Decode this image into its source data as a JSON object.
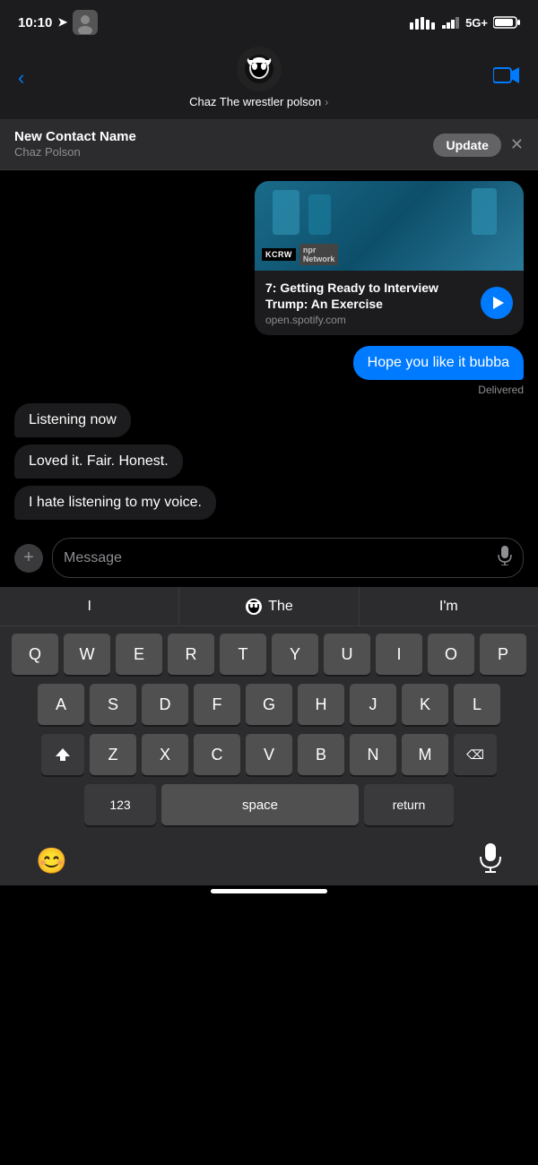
{
  "status_bar": {
    "time": "10:10",
    "network": "5G+",
    "signal_bars": "▂▄▆█"
  },
  "nav_bar": {
    "back_label": "‹",
    "contact_name": "Chaz The wrestler polson",
    "chevron": "›",
    "video_icon": "video-icon"
  },
  "new_contact_banner": {
    "title": "New Contact Name",
    "subtitle": "Chaz Polson",
    "update_btn": "Update",
    "close_btn": "✕"
  },
  "spotify_card": {
    "track_title": "7: Getting Ready to Interview Trump: An Exercise",
    "track_url": "open.spotify.com",
    "play_btn_label": "play"
  },
  "sent_message": {
    "text": "Hope you like it bubba",
    "status": "Delivered"
  },
  "received_messages": [
    {
      "text": "Listening now"
    },
    {
      "text": "Loved it. Fair. Honest."
    },
    {
      "text": "I hate listening to my voice."
    }
  ],
  "message_input": {
    "placeholder": "Message",
    "plus_label": "+"
  },
  "keyboard": {
    "suggestions": [
      "I",
      "The",
      "I'm"
    ],
    "rows": [
      [
        "Q",
        "W",
        "E",
        "R",
        "T",
        "Y",
        "U",
        "I",
        "O",
        "P"
      ],
      [
        "A",
        "S",
        "D",
        "F",
        "G",
        "H",
        "J",
        "K",
        "L"
      ],
      [
        "Z",
        "X",
        "C",
        "V",
        "B",
        "N",
        "M"
      ],
      [
        "123",
        "space",
        "return"
      ]
    ],
    "space_label": "space",
    "return_label": "return",
    "num_label": "123",
    "shift_label": "⇧",
    "delete_label": "⌫"
  },
  "bottom_bar": {
    "emoji_icon": "emoji-icon",
    "mic_icon": "mic-icon"
  }
}
